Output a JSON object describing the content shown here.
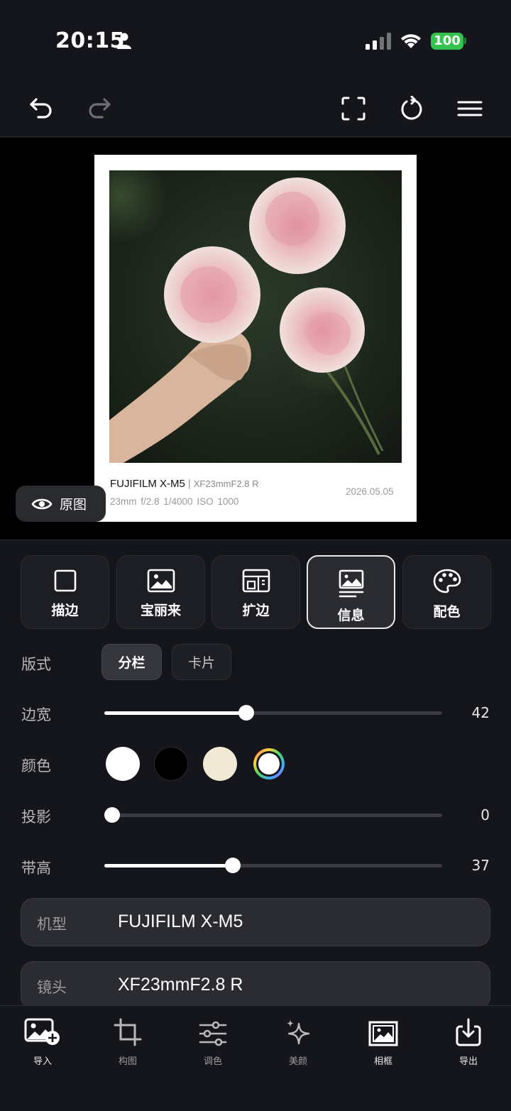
{
  "status_bar": {
    "time": "20:15",
    "battery": "100"
  },
  "toolbar": {
    "icons": [
      "undo-icon",
      "redo-icon",
      "fullscreen-icon",
      "reset-icon",
      "menu-icon"
    ]
  },
  "preview": {
    "camera": "FUJIFILM X-M5",
    "separator": "|",
    "lens": "XF23mmF2.8 R",
    "params": "23mm  f/2.8  1/4000  ISO 1000",
    "date": "2026.05.05",
    "original_button": "原图"
  },
  "tabs": [
    {
      "label": "描边",
      "icon": "stroke-icon",
      "active": false
    },
    {
      "label": "宝丽来",
      "icon": "polaroid-icon",
      "active": false
    },
    {
      "label": "扩边",
      "icon": "expand-icon",
      "active": false
    },
    {
      "label": "信息",
      "icon": "info-icon",
      "active": true
    },
    {
      "label": "配色",
      "icon": "palette-icon",
      "active": false
    }
  ],
  "layout": {
    "label": "版式",
    "options": [
      "分栏",
      "卡片"
    ],
    "selected": "分栏"
  },
  "border_width": {
    "label": "边宽",
    "value": "42",
    "fraction": 0.42
  },
  "color": {
    "label": "颜色",
    "swatches": [
      "#ffffff",
      "#000000",
      "#f2e8d6",
      "custom"
    ]
  },
  "shadow": {
    "label": "投影",
    "value": "0",
    "fraction": 0.0
  },
  "band_height": {
    "label": "带高",
    "value": "37",
    "fraction": 0.38
  },
  "fields": [
    {
      "label": "机型",
      "value": "FUJIFILM X-M5"
    },
    {
      "label": "镜头",
      "value": "XF23mmF2.8 R"
    }
  ],
  "bottom_nav": [
    {
      "label": "导入",
      "icon": "import-image-icon"
    },
    {
      "label": "构图",
      "icon": "crop-icon"
    },
    {
      "label": "调色",
      "icon": "adjust-sliders-icon"
    },
    {
      "label": "美颜",
      "icon": "sparkle-icon"
    },
    {
      "label": "相框",
      "icon": "frame-icon",
      "active": true
    },
    {
      "label": "导出",
      "icon": "export-icon"
    }
  ]
}
